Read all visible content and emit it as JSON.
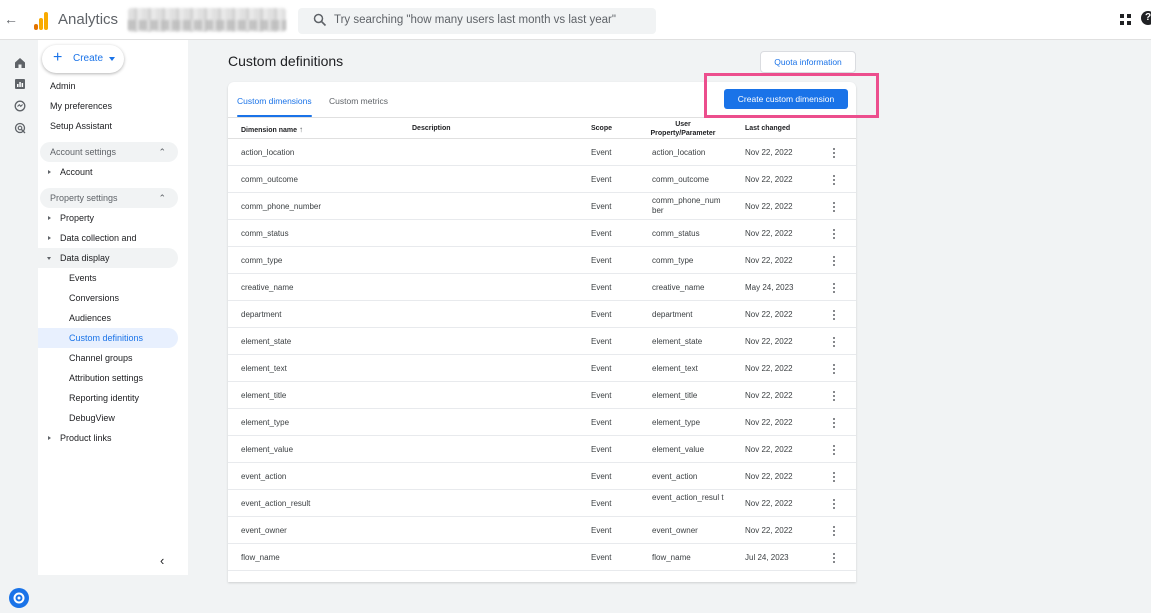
{
  "app": {
    "title": "Analytics",
    "search_placeholder": "Try searching \"how many users last month vs last year\""
  },
  "sidenav": {
    "create_label": "Create",
    "top_items": [
      "Admin",
      "My preferences",
      "Setup Assistant"
    ],
    "account_settings": "Account settings",
    "account": "Account",
    "property_settings": "Property settings",
    "property": "Property",
    "data_collection": "Data collection and modifica...",
    "data_display": "Data display",
    "sub_items": [
      "Events",
      "Conversions",
      "Audiences",
      "Custom definitions",
      "Channel groups",
      "Attribution settings",
      "Reporting identity",
      "DebugView"
    ],
    "active_item": "Custom definitions",
    "product_links": "Product links"
  },
  "main": {
    "title": "Custom definitions",
    "quota_button": "Quota information",
    "tabs": [
      "Custom dimensions",
      "Custom metrics"
    ],
    "create_button": "Create custom dimension",
    "columns": {
      "dimension_name": "Dimension name",
      "description": "Description",
      "scope": "Scope",
      "user_property": "User Property/Parameter",
      "last_changed": "Last changed"
    },
    "rows": [
      {
        "name": "action_location",
        "scope": "Event",
        "param": "action_location",
        "changed": "Nov 22, 2022"
      },
      {
        "name": "comm_outcome",
        "scope": "Event",
        "param": "comm_outcome",
        "changed": "Nov 22, 2022"
      },
      {
        "name": "comm_phone_number",
        "scope": "Event",
        "param": "comm_phone_num ber",
        "changed": "Nov 22, 2022"
      },
      {
        "name": "comm_status",
        "scope": "Event",
        "param": "comm_status",
        "changed": "Nov 22, 2022"
      },
      {
        "name": "comm_type",
        "scope": "Event",
        "param": "comm_type",
        "changed": "Nov 22, 2022"
      },
      {
        "name": "creative_name",
        "scope": "Event",
        "param": "creative_name",
        "changed": "May 24, 2023"
      },
      {
        "name": "department",
        "scope": "Event",
        "param": "department",
        "changed": "Nov 22, 2022"
      },
      {
        "name": "element_state",
        "scope": "Event",
        "param": "element_state",
        "changed": "Nov 22, 2022"
      },
      {
        "name": "element_text",
        "scope": "Event",
        "param": "element_text",
        "changed": "Nov 22, 2022"
      },
      {
        "name": "element_title",
        "scope": "Event",
        "param": "element_title",
        "changed": "Nov 22, 2022"
      },
      {
        "name": "element_type",
        "scope": "Event",
        "param": "element_type",
        "changed": "Nov 22, 2022"
      },
      {
        "name": "element_value",
        "scope": "Event",
        "param": "element_value",
        "changed": "Nov 22, 2022"
      },
      {
        "name": "event_action",
        "scope": "Event",
        "param": "event_action",
        "changed": "Nov 22, 2022"
      },
      {
        "name": "event_action_result",
        "scope": "Event",
        "param": "event_action_resul t",
        "changed": "Nov 22, 2022"
      },
      {
        "name": "event_owner",
        "scope": "Event",
        "param": "event_owner",
        "changed": "Nov 22, 2022"
      },
      {
        "name": "flow_name",
        "scope": "Event",
        "param": "flow_name",
        "changed": "Jul 24, 2023"
      }
    ]
  },
  "colors": {
    "accent": "#1a73e8",
    "highlight": "#ec4e8d",
    "logo_orange": "#f9ab00",
    "logo_dark": "#e37400"
  }
}
